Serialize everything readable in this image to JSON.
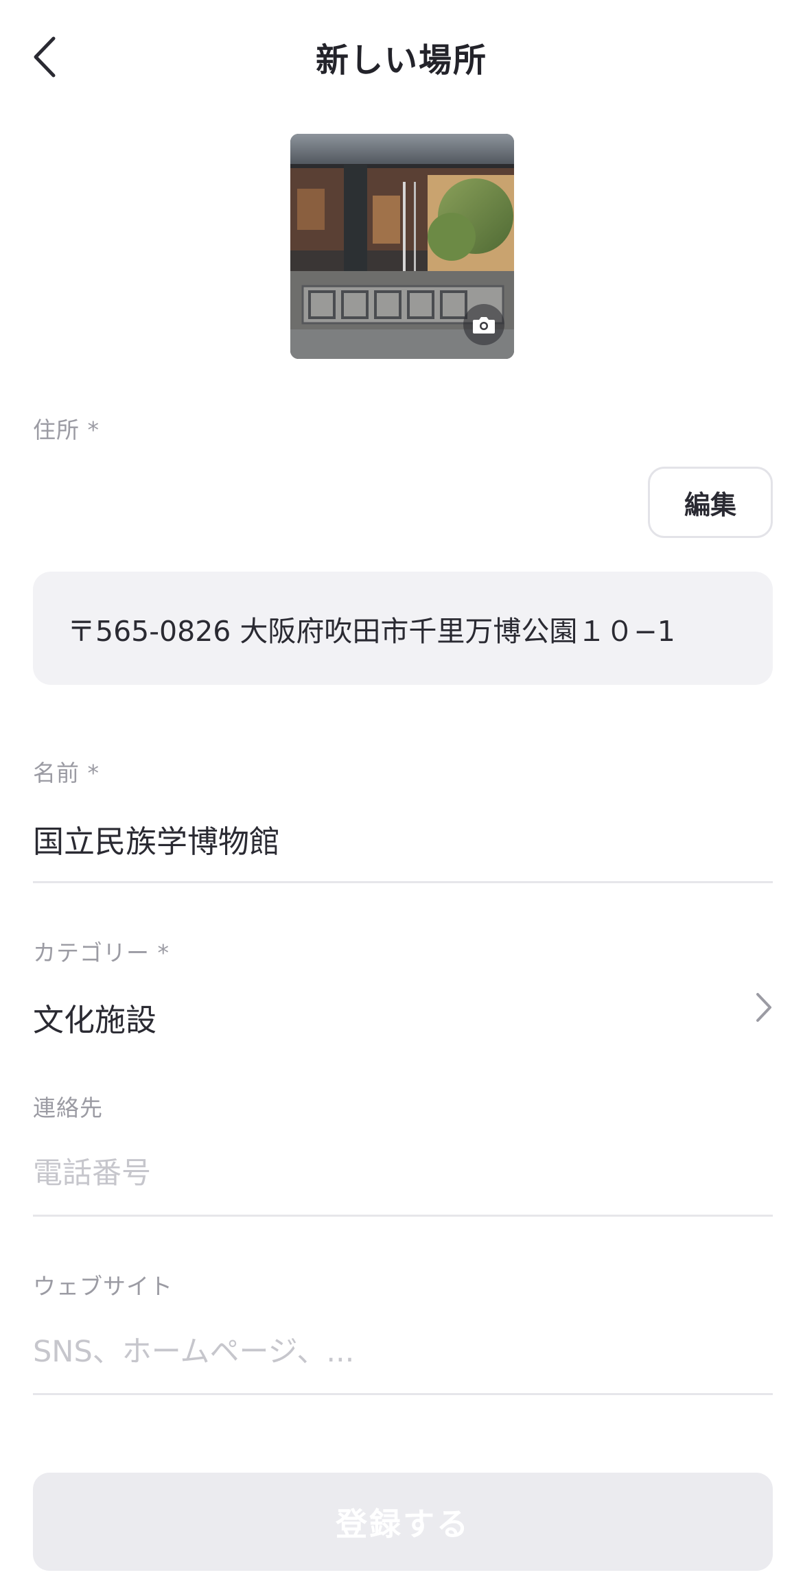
{
  "header": {
    "title": "新しい場所"
  },
  "address": {
    "label": "住所 *",
    "edit_label": "編集",
    "value": "〒565-0826 大阪府吹田市千里万博公園１０−1"
  },
  "name": {
    "label": "名前 *",
    "value": "国立民族学博物館"
  },
  "category": {
    "label": "カテゴリー *",
    "value": "文化施設"
  },
  "contact": {
    "label": "連絡先",
    "placeholder": "電話番号"
  },
  "website": {
    "label": "ウェブサイト",
    "placeholder": "SNS、ホームページ、..."
  },
  "submit": {
    "label": "登録する"
  },
  "icons": {
    "back": "chevron-left-icon",
    "camera": "camera-icon",
    "category_arrow": "chevron-right-icon"
  },
  "colors": {
    "text": "#2a2a32",
    "label": "#9b9ba3",
    "placeholder": "#c6c6cc",
    "field_bg": "#f2f2f5",
    "button_disabled": "#ebebef"
  }
}
